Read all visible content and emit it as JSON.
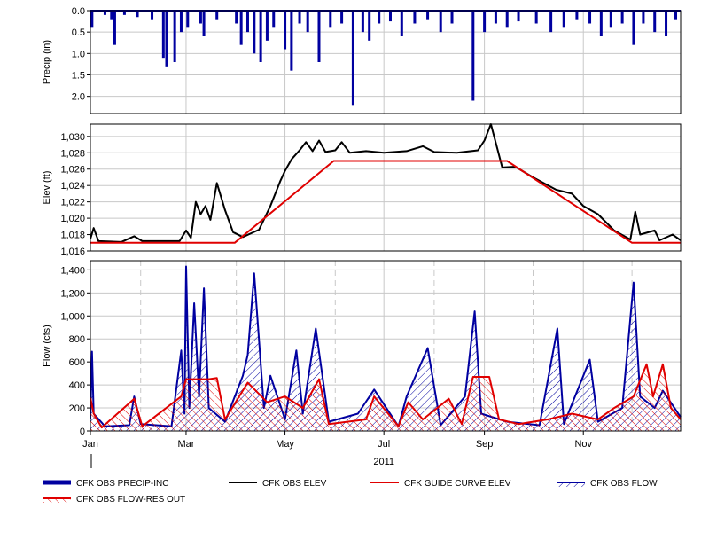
{
  "chart_data": [
    {
      "type": "bar",
      "ylabel": "Precip (in)",
      "ylim": [
        2.4,
        0.0
      ],
      "inverted": true,
      "yticks": [
        {
          "v": 0.0,
          "label": "0.0"
        },
        {
          "v": 0.5,
          "label": "0.5"
        },
        {
          "v": 1.0,
          "label": "1.0"
        },
        {
          "v": 1.5,
          "label": "1.5"
        },
        {
          "v": 2.0,
          "label": "2.0"
        }
      ],
      "grid": true,
      "color": "#0000a0",
      "series": [
        {
          "name": "CFK OBS PRECIP-INC",
          "points": [
            [
              "2011-01-02",
              0.4
            ],
            [
              "2011-01-10",
              0.1
            ],
            [
              "2011-01-14",
              0.2
            ],
            [
              "2011-01-16",
              0.8
            ],
            [
              "2011-01-22",
              0.1
            ],
            [
              "2011-01-30",
              0.15
            ],
            [
              "2011-02-08",
              0.2
            ],
            [
              "2011-02-15",
              1.1
            ],
            [
              "2011-02-17",
              1.3
            ],
            [
              "2011-02-22",
              1.2
            ],
            [
              "2011-02-26",
              0.5
            ],
            [
              "2011-03-02",
              0.4
            ],
            [
              "2011-03-10",
              0.3
            ],
            [
              "2011-03-12",
              0.6
            ],
            [
              "2011-03-20",
              0.2
            ],
            [
              "2011-04-01",
              0.3
            ],
            [
              "2011-04-04",
              0.8
            ],
            [
              "2011-04-08",
              0.5
            ],
            [
              "2011-04-12",
              1.0
            ],
            [
              "2011-04-16",
              1.2
            ],
            [
              "2011-04-20",
              0.7
            ],
            [
              "2011-04-24",
              0.4
            ],
            [
              "2011-05-01",
              0.9
            ],
            [
              "2011-05-05",
              1.4
            ],
            [
              "2011-05-10",
              0.3
            ],
            [
              "2011-05-15",
              0.5
            ],
            [
              "2011-05-22",
              1.2
            ],
            [
              "2011-05-29",
              0.4
            ],
            [
              "2011-06-05",
              0.3
            ],
            [
              "2011-06-12",
              2.2
            ],
            [
              "2011-06-18",
              0.5
            ],
            [
              "2011-06-22",
              0.7
            ],
            [
              "2011-06-28",
              0.3
            ],
            [
              "2011-07-05",
              0.25
            ],
            [
              "2011-07-12",
              0.6
            ],
            [
              "2011-07-20",
              0.3
            ],
            [
              "2011-07-28",
              0.2
            ],
            [
              "2011-08-05",
              0.5
            ],
            [
              "2011-08-12",
              0.3
            ],
            [
              "2011-08-25",
              2.1
            ],
            [
              "2011-09-01",
              0.5
            ],
            [
              "2011-09-08",
              0.3
            ],
            [
              "2011-09-15",
              0.4
            ],
            [
              "2011-09-22",
              0.25
            ],
            [
              "2011-10-03",
              0.3
            ],
            [
              "2011-10-12",
              0.5
            ],
            [
              "2011-10-20",
              0.4
            ],
            [
              "2011-10-28",
              0.2
            ],
            [
              "2011-11-05",
              0.3
            ],
            [
              "2011-11-12",
              0.6
            ],
            [
              "2011-11-18",
              0.4
            ],
            [
              "2011-11-25",
              0.3
            ],
            [
              "2011-12-02",
              0.8
            ],
            [
              "2011-12-08",
              0.3
            ],
            [
              "2011-12-15",
              0.5
            ],
            [
              "2011-12-22",
              0.6
            ],
            [
              "2011-12-28",
              0.2
            ]
          ]
        }
      ]
    },
    {
      "type": "line",
      "ylabel": "Elev (ft)",
      "ylim": [
        1016,
        1031.5
      ],
      "yticks": [
        {
          "v": 1016,
          "label": "1,016"
        },
        {
          "v": 1018,
          "label": "1,018"
        },
        {
          "v": 1020,
          "label": "1,020"
        },
        {
          "v": 1022,
          "label": "1,022"
        },
        {
          "v": 1024,
          "label": "1,024"
        },
        {
          "v": 1026,
          "label": "1,026"
        },
        {
          "v": 1028,
          "label": "1,028"
        },
        {
          "v": 1030,
          "label": "1,030"
        }
      ],
      "grid": true,
      "series": [
        {
          "name": "CFK OBS ELEV",
          "color": "#000000",
          "points": [
            [
              "2011-01-01",
              1017.5
            ],
            [
              "2011-01-03",
              1018.8
            ],
            [
              "2011-01-06",
              1017.2
            ],
            [
              "2011-01-20",
              1017.1
            ],
            [
              "2011-01-28",
              1017.8
            ],
            [
              "2011-02-02",
              1017.2
            ],
            [
              "2011-02-25",
              1017.2
            ],
            [
              "2011-03-01",
              1018.5
            ],
            [
              "2011-03-04",
              1017.6
            ],
            [
              "2011-03-07",
              1022.0
            ],
            [
              "2011-03-10",
              1020.5
            ],
            [
              "2011-03-13",
              1021.5
            ],
            [
              "2011-03-16",
              1019.8
            ],
            [
              "2011-03-20",
              1024.3
            ],
            [
              "2011-03-25",
              1021.0
            ],
            [
              "2011-03-30",
              1018.3
            ],
            [
              "2011-04-05",
              1017.7
            ],
            [
              "2011-04-15",
              1018.6
            ],
            [
              "2011-04-22",
              1021.5
            ],
            [
              "2011-04-28",
              1024.5
            ],
            [
              "2011-05-01",
              1025.8
            ],
            [
              "2011-05-05",
              1027.2
            ],
            [
              "2011-05-10",
              1028.3
            ],
            [
              "2011-05-14",
              1029.3
            ],
            [
              "2011-05-18",
              1028.2
            ],
            [
              "2011-05-22",
              1029.5
            ],
            [
              "2011-05-26",
              1028.1
            ],
            [
              "2011-06-01",
              1028.3
            ],
            [
              "2011-06-05",
              1029.3
            ],
            [
              "2011-06-10",
              1028.0
            ],
            [
              "2011-06-20",
              1028.2
            ],
            [
              "2011-07-01",
              1028.0
            ],
            [
              "2011-07-15",
              1028.2
            ],
            [
              "2011-07-25",
              1028.8
            ],
            [
              "2011-08-01",
              1028.1
            ],
            [
              "2011-08-15",
              1028.0
            ],
            [
              "2011-08-28",
              1028.3
            ],
            [
              "2011-09-01",
              1029.5
            ],
            [
              "2011-09-05",
              1031.5
            ],
            [
              "2011-09-09",
              1028.5
            ],
            [
              "2011-09-12",
              1026.2
            ],
            [
              "2011-09-20",
              1026.3
            ],
            [
              "2011-10-01",
              1025.0
            ],
            [
              "2011-10-15",
              1023.5
            ],
            [
              "2011-10-25",
              1023.0
            ],
            [
              "2011-11-01",
              1021.5
            ],
            [
              "2011-11-10",
              1020.5
            ],
            [
              "2011-11-20",
              1018.5
            ],
            [
              "2011-11-30",
              1017.4
            ],
            [
              "2011-12-03",
              1020.8
            ],
            [
              "2011-12-06",
              1018.0
            ],
            [
              "2011-12-15",
              1018.5
            ],
            [
              "2011-12-18",
              1017.3
            ],
            [
              "2011-12-26",
              1018.0
            ],
            [
              "2011-12-31",
              1017.3
            ]
          ]
        },
        {
          "name": "CFK GUIDE CURVE ELEV",
          "color": "#e00000",
          "points": [
            [
              "2011-01-01",
              1017.0
            ],
            [
              "2011-03-31",
              1017.0
            ],
            [
              "2011-05-31",
              1027.0
            ],
            [
              "2011-09-15",
              1027.0
            ],
            [
              "2011-12-01",
              1017.0
            ],
            [
              "2011-12-31",
              1017.0
            ]
          ]
        }
      ]
    },
    {
      "type": "line",
      "ylabel": "Flow (cfs)",
      "ylim": [
        0,
        1480
      ],
      "yticks": [
        {
          "v": 0,
          "label": "0"
        },
        {
          "v": 200,
          "label": "200"
        },
        {
          "v": 400,
          "label": "400"
        },
        {
          "v": 600,
          "label": "600"
        },
        {
          "v": 800,
          "label": "800"
        },
        {
          "v": 1000,
          "label": "1,000"
        },
        {
          "v": 1200,
          "label": "1,200"
        },
        {
          "v": 1400,
          "label": "1,400"
        }
      ],
      "grid": true,
      "xlabel": "2011",
      "xticks": [
        {
          "date": "2011-01-01",
          "label": "Jan"
        },
        {
          "date": "2011-03-01",
          "label": "Mar"
        },
        {
          "date": "2011-05-01",
          "label": "May"
        },
        {
          "date": "2011-07-01",
          "label": "Jul"
        },
        {
          "date": "2011-09-01",
          "label": "Sep"
        },
        {
          "date": "2011-11-01",
          "label": "Nov"
        }
      ],
      "series": [
        {
          "name": "CFK OBS FLOW",
          "color": "#0000a0",
          "fill": "hatched",
          "points": [
            [
              "2011-01-01",
              100
            ],
            [
              "2011-01-02",
              690
            ],
            [
              "2011-01-03",
              150
            ],
            [
              "2011-01-10",
              40
            ],
            [
              "2011-01-25",
              50
            ],
            [
              "2011-01-28",
              300
            ],
            [
              "2011-02-01",
              60
            ],
            [
              "2011-02-20",
              40
            ],
            [
              "2011-02-26",
              700
            ],
            [
              "2011-02-28",
              150
            ],
            [
              "2011-03-01",
              1430
            ],
            [
              "2011-03-03",
              200
            ],
            [
              "2011-03-06",
              1110
            ],
            [
              "2011-03-09",
              300
            ],
            [
              "2011-03-12",
              1240
            ],
            [
              "2011-03-15",
              200
            ],
            [
              "2011-03-25",
              80
            ],
            [
              "2011-04-05",
              480
            ],
            [
              "2011-04-08",
              660
            ],
            [
              "2011-04-12",
              1370
            ],
            [
              "2011-04-18",
              200
            ],
            [
              "2011-04-22",
              480
            ],
            [
              "2011-05-01",
              100
            ],
            [
              "2011-05-08",
              700
            ],
            [
              "2011-05-12",
              150
            ],
            [
              "2011-05-20",
              890
            ],
            [
              "2011-05-28",
              80
            ],
            [
              "2011-06-15",
              150
            ],
            [
              "2011-06-25",
              360
            ],
            [
              "2011-07-10",
              40
            ],
            [
              "2011-07-15",
              300
            ],
            [
              "2011-07-28",
              720
            ],
            [
              "2011-08-05",
              50
            ],
            [
              "2011-08-20",
              300
            ],
            [
              "2011-08-26",
              1040
            ],
            [
              "2011-08-30",
              150
            ],
            [
              "2011-09-15",
              80
            ],
            [
              "2011-10-05",
              50
            ],
            [
              "2011-10-16",
              890
            ],
            [
              "2011-10-20",
              60
            ],
            [
              "2011-11-05",
              620
            ],
            [
              "2011-11-10",
              80
            ],
            [
              "2011-11-25",
              200
            ],
            [
              "2011-12-02",
              1290
            ],
            [
              "2011-12-06",
              300
            ],
            [
              "2011-12-15",
              200
            ],
            [
              "2011-12-20",
              350
            ],
            [
              "2011-12-31",
              120
            ]
          ]
        },
        {
          "name": "CFK OBS FLOW-RES OUT",
          "color": "#e00000",
          "fill": "hatched",
          "points": [
            [
              "2011-01-01",
              290
            ],
            [
              "2011-01-03",
              150
            ],
            [
              "2011-01-08",
              30
            ],
            [
              "2011-01-28",
              280
            ],
            [
              "2011-02-02",
              40
            ],
            [
              "2011-02-26",
              300
            ],
            [
              "2011-03-01",
              450
            ],
            [
              "2011-03-15",
              450
            ],
            [
              "2011-03-20",
              460
            ],
            [
              "2011-03-25",
              100
            ],
            [
              "2011-04-08",
              420
            ],
            [
              "2011-04-13",
              350
            ],
            [
              "2011-04-20",
              250
            ],
            [
              "2011-05-01",
              300
            ],
            [
              "2011-05-12",
              200
            ],
            [
              "2011-05-22",
              450
            ],
            [
              "2011-05-28",
              60
            ],
            [
              "2011-06-20",
              100
            ],
            [
              "2011-06-25",
              300
            ],
            [
              "2011-07-10",
              40
            ],
            [
              "2011-07-16",
              250
            ],
            [
              "2011-07-25",
              100
            ],
            [
              "2011-08-10",
              280
            ],
            [
              "2011-08-18",
              60
            ],
            [
              "2011-08-25",
              470
            ],
            [
              "2011-09-04",
              470
            ],
            [
              "2011-09-10",
              100
            ],
            [
              "2011-09-22",
              60
            ],
            [
              "2011-10-10",
              100
            ],
            [
              "2011-10-25",
              150
            ],
            [
              "2011-11-10",
              100
            ],
            [
              "2011-11-20",
              200
            ],
            [
              "2011-12-02",
              300
            ],
            [
              "2011-12-10",
              580
            ],
            [
              "2011-12-14",
              300
            ],
            [
              "2011-12-20",
              580
            ],
            [
              "2011-12-25",
              200
            ],
            [
              "2011-12-31",
              100
            ]
          ]
        }
      ]
    }
  ],
  "legend": {
    "placement": "bottom",
    "items": [
      {
        "label": "CFK OBS PRECIP-INC",
        "color": "#0000a0",
        "style": "thick"
      },
      {
        "label": "CFK OBS ELEV",
        "color": "#000000",
        "style": "line"
      },
      {
        "label": "CFK GUIDE CURVE ELEV",
        "color": "#e00000",
        "style": "line"
      },
      {
        "label": "CFK OBS FLOW",
        "color": "#0000a0",
        "style": "hatched"
      },
      {
        "label": "CFK OBS FLOW-RES OUT",
        "color": "#e00000",
        "style": "hatched"
      }
    ]
  }
}
